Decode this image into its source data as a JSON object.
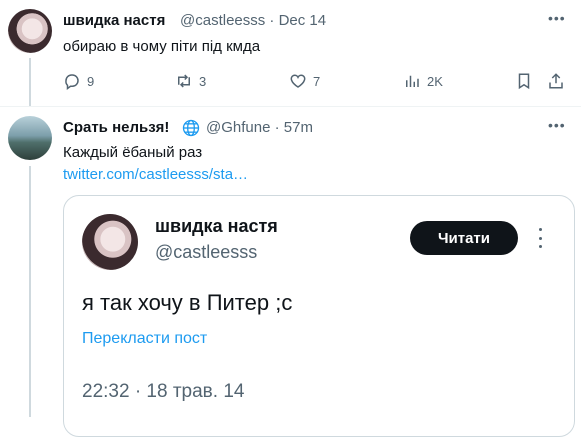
{
  "tweet1": {
    "name": "швидка настя",
    "handle_time": "@castleesss · Dec 14",
    "text": "обираю в чому піти під кмда",
    "actions": {
      "replies": "9",
      "reposts": "3",
      "likes": "7",
      "views": "2K"
    },
    "icons": [
      "reply-icon",
      "repost-icon",
      "like-icon",
      "views-icon",
      "bookmark-icon",
      "share-icon"
    ]
  },
  "tweet2": {
    "name": "Срать нельзя!",
    "handle_time": "@Ghfune · 57m",
    "text": "Каждый ёбаный раз",
    "link": "twitter.com/castleesss/sta…"
  },
  "quoted": {
    "name": "швидка настя",
    "handle": "@castleesss",
    "read_button": "Читати",
    "text": "я так хочу в Питер ;с",
    "translate": "Перекласти пост",
    "datetime": "22:32 · 18 трав. 14"
  },
  "colors": {
    "accent": "#1d9bf0",
    "muted": "#536471",
    "text": "#0f1419",
    "border": "#cfd9de"
  }
}
